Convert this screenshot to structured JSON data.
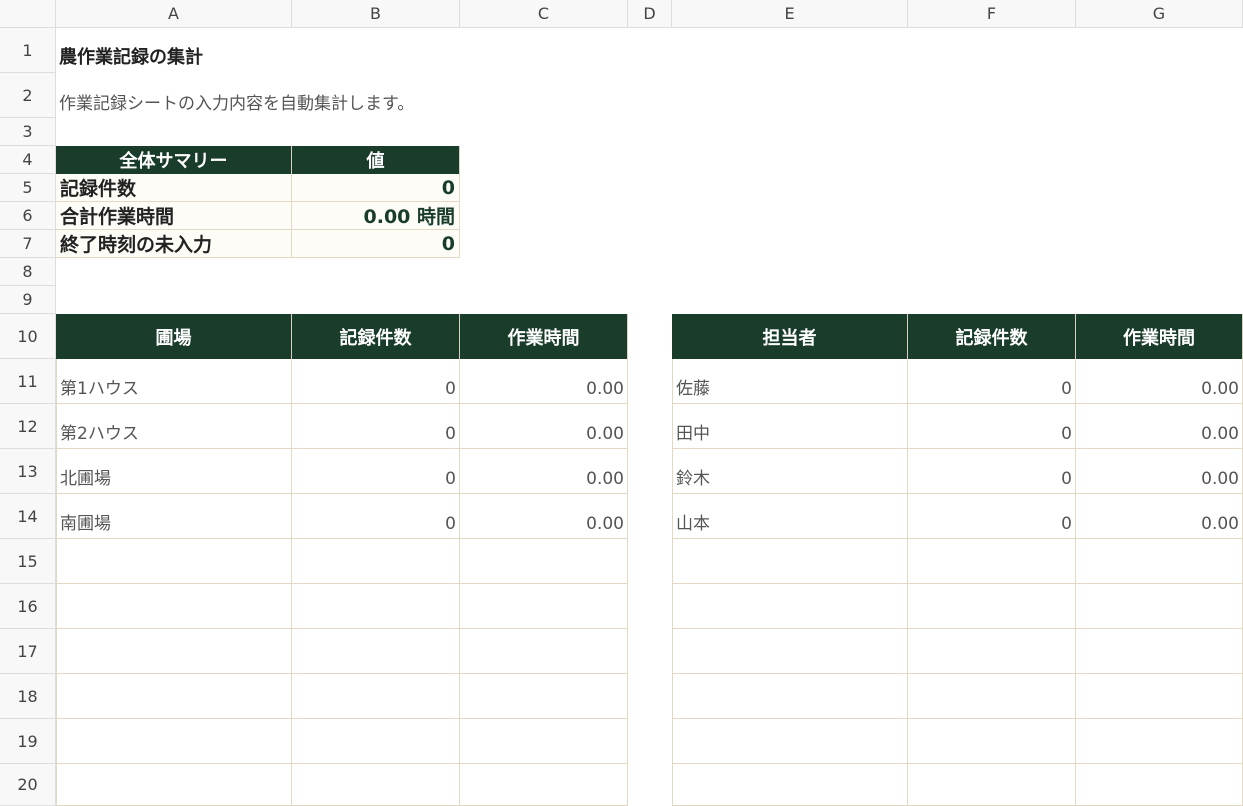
{
  "columns": [
    "A",
    "B",
    "C",
    "D",
    "E",
    "F",
    "G"
  ],
  "rows": [
    "1",
    "2",
    "3",
    "4",
    "5",
    "6",
    "7",
    "8",
    "9",
    "10",
    "11",
    "12",
    "13",
    "14",
    "15",
    "16",
    "17",
    "18",
    "19",
    "20"
  ],
  "title": "農作業記録の集計",
  "subtitle": "作業記録シートの入力内容を自動集計します。",
  "summary": {
    "header_label": "全体サマリー",
    "header_value": "値",
    "items": [
      {
        "label": "記録件数",
        "value": "0"
      },
      {
        "label": "合計作業時間",
        "value": "0.00 時間"
      },
      {
        "label": "終了時刻の未入力",
        "value": "0"
      }
    ]
  },
  "field_table": {
    "headers": [
      "圃場",
      "記録件数",
      "作業時間"
    ],
    "rows": [
      [
        "第1ハウス",
        "0",
        "0.00"
      ],
      [
        "第2ハウス",
        "0",
        "0.00"
      ],
      [
        "北圃場",
        "0",
        "0.00"
      ],
      [
        "南圃場",
        "0",
        "0.00"
      ]
    ]
  },
  "person_table": {
    "headers": [
      "担当者",
      "記録件数",
      "作業時間"
    ],
    "rows": [
      [
        "佐藤",
        "0",
        "0.00"
      ],
      [
        "田中",
        "0",
        "0.00"
      ],
      [
        "鈴木",
        "0",
        "0.00"
      ],
      [
        "山本",
        "0",
        "0.00"
      ]
    ]
  },
  "colors": {
    "header_bg": "#1a3d2b",
    "border": "#e2d8c4",
    "summary_bg": "#fdfcf7"
  }
}
